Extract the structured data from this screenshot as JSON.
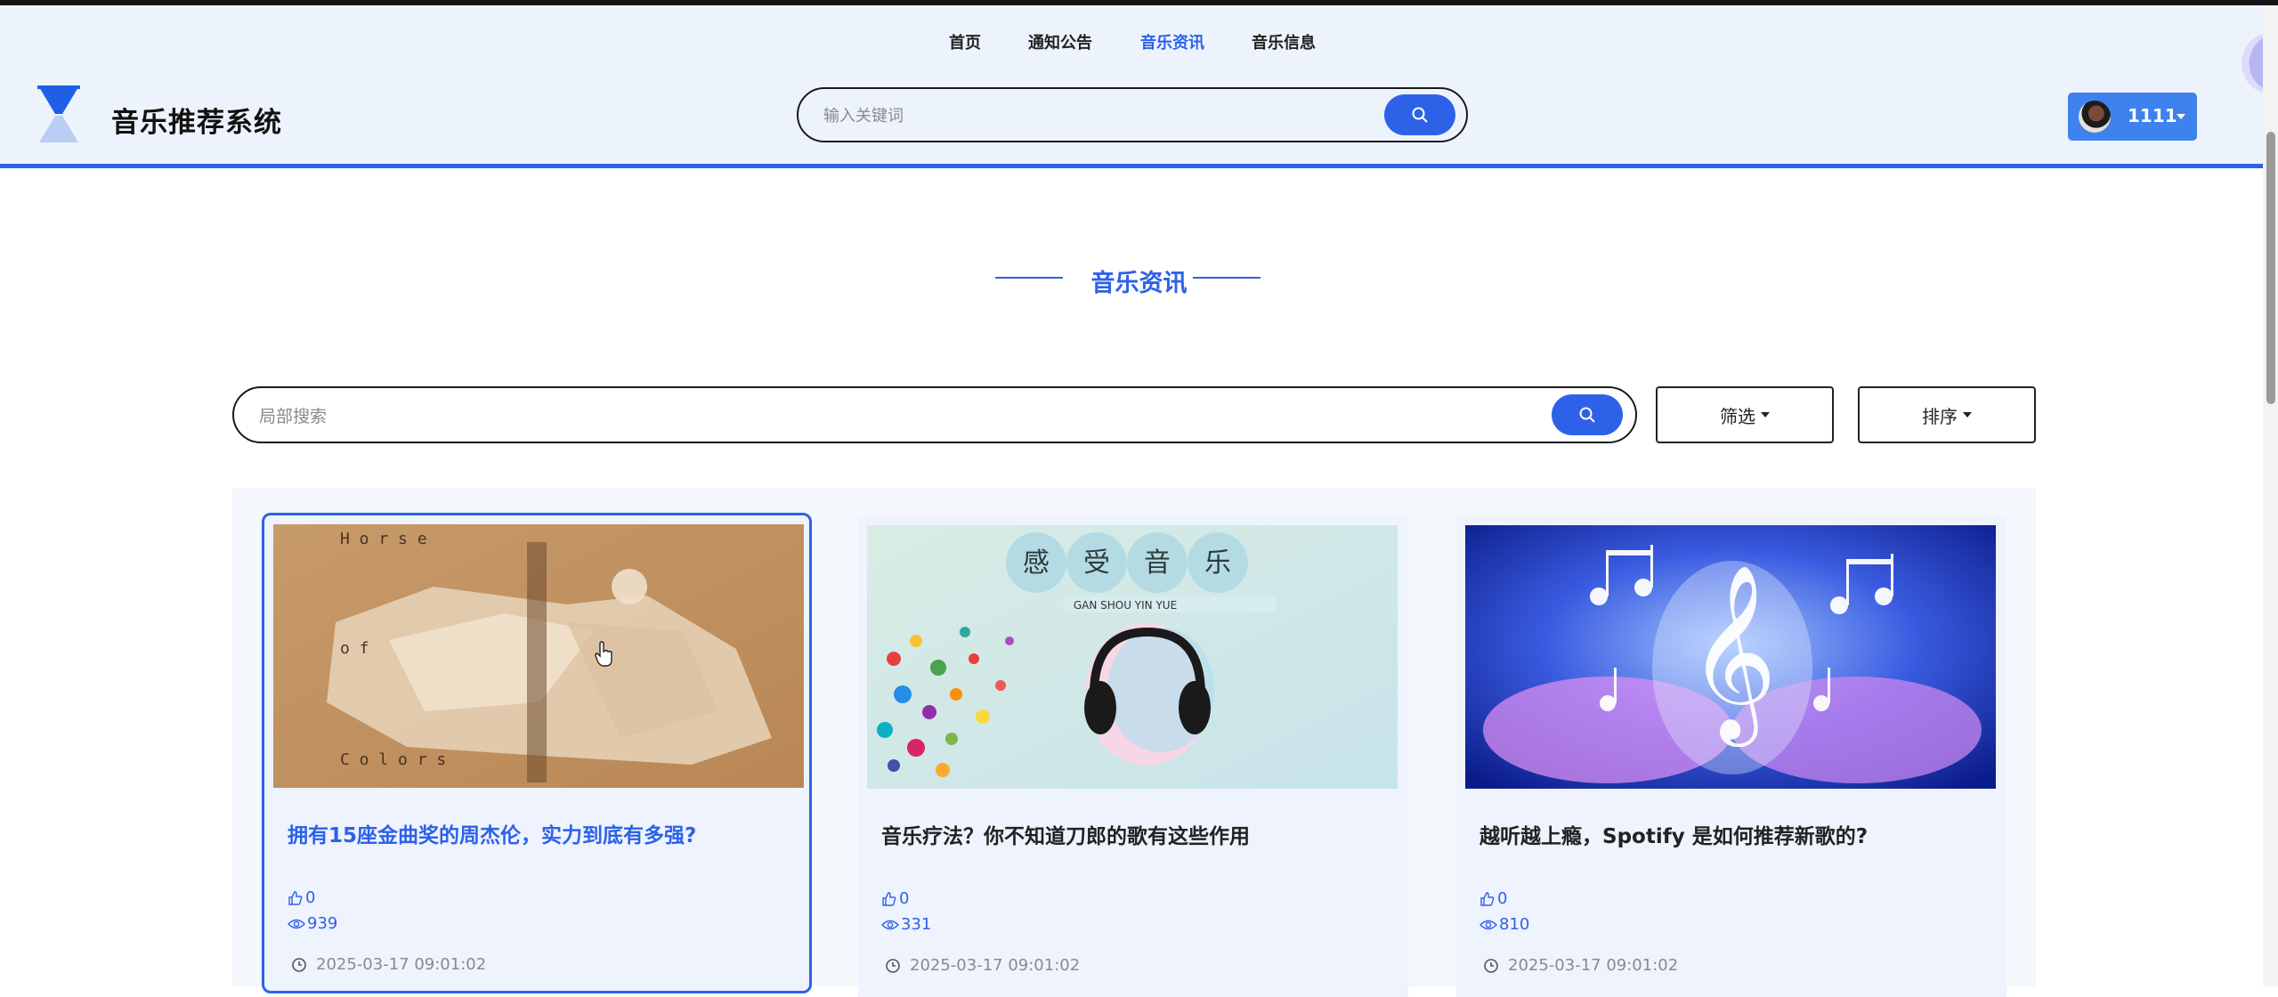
{
  "nav": {
    "items": [
      {
        "label": "首页",
        "active": false
      },
      {
        "label": "通知公告",
        "active": false
      },
      {
        "label": "音乐资讯",
        "active": true
      },
      {
        "label": "音乐信息",
        "active": false
      }
    ]
  },
  "header": {
    "site_title": "音乐推荐系统",
    "search_placeholder": "输入关键词",
    "user_name": "1111"
  },
  "section": {
    "title": "音乐资讯"
  },
  "toolbar": {
    "search_placeholder": "局部搜索",
    "filter_label": "筛选",
    "sort_label": "排序"
  },
  "colors": {
    "accent": "#2d62e8",
    "header_bg": "#edf3fc",
    "card_bg": "#eef3fd"
  },
  "cards": [
    {
      "title": "拥有15座金曲奖的周杰伦，实力到底有多强?",
      "likes": "0",
      "views": "939",
      "date": "2025-03-17 09:01:02",
      "image_text": [
        "H o r s e",
        "o f",
        "C o l o r s"
      ]
    },
    {
      "title": "音乐疗法？你不知道刀郎的歌有这些作用",
      "likes": "0",
      "views": "331",
      "date": "2025-03-17 09:01:02",
      "image_text": [
        "感",
        "受",
        "音",
        "乐",
        "GAN SHOU YIN YUE"
      ]
    },
    {
      "title": "越听越上瘾，Spotify 是如何推荐新歌的?",
      "likes": "0",
      "views": "810",
      "date": "2025-03-17 09:01:02",
      "image_text": []
    }
  ]
}
